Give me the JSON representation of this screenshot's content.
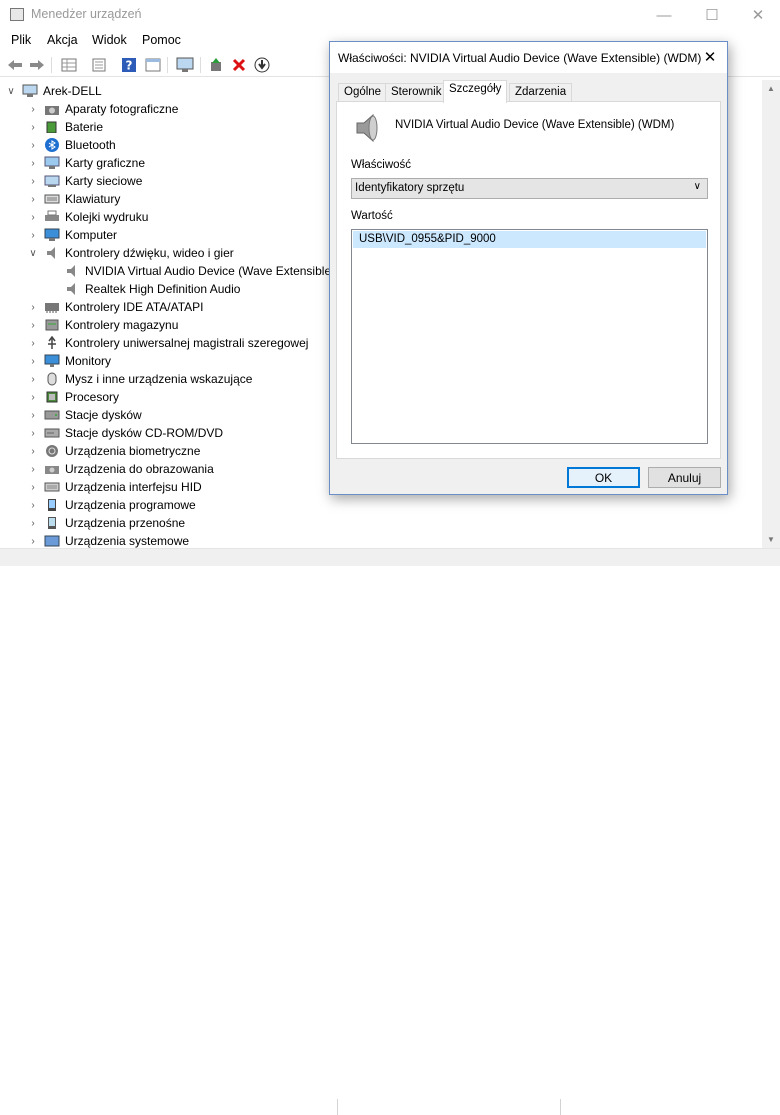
{
  "window": {
    "title": "Menedżer urządzeń"
  },
  "menu": [
    "Plik",
    "Akcja",
    "Widok",
    "Pomoc"
  ],
  "toolbar_icons": [
    "back-arrow-icon",
    "forward-arrow-icon",
    "properties-grid-icon",
    "list-icon",
    "help-icon",
    "show-hidden-icon",
    "monitor-icon",
    "update-driver-icon",
    "uninstall-icon",
    "download-icon"
  ],
  "tree": {
    "root": "Arek-DELL",
    "categories": [
      {
        "label": "Aparaty fotograficzne",
        "icon": "camera-icon"
      },
      {
        "label": "Baterie",
        "icon": "battery-icon"
      },
      {
        "label": "Bluetooth",
        "icon": "bluetooth-icon"
      },
      {
        "label": "Karty graficzne",
        "icon": "display-adapter-icon"
      },
      {
        "label": "Karty sieciowe",
        "icon": "network-adapter-icon"
      },
      {
        "label": "Klawiatury",
        "icon": "keyboard-icon"
      },
      {
        "label": "Kolejki wydruku",
        "icon": "printer-icon"
      },
      {
        "label": "Komputer",
        "icon": "computer-icon"
      },
      {
        "label": "Kontrolery dźwięku, wideo i gier",
        "icon": "speaker-icon",
        "expanded": true,
        "children": [
          "NVIDIA Virtual Audio Device (Wave Extensible) (WDM)",
          "Realtek High Definition Audio"
        ]
      },
      {
        "label": "Kontrolery IDE ATA/ATAPI",
        "icon": "ide-controller-icon"
      },
      {
        "label": "Kontrolery magazynu",
        "icon": "storage-controller-icon"
      },
      {
        "label": "Kontrolery uniwersalnej magistrali szeregowej",
        "icon": "usb-icon"
      },
      {
        "label": "Monitory",
        "icon": "monitor-icon"
      },
      {
        "label": "Mysz i inne urządzenia wskazujące",
        "icon": "mouse-icon"
      },
      {
        "label": "Procesory",
        "icon": "processor-icon"
      },
      {
        "label": "Stacje dysków",
        "icon": "disk-drive-icon"
      },
      {
        "label": "Stacje dysków CD-ROM/DVD",
        "icon": "cdrom-icon"
      },
      {
        "label": "Urządzenia biometryczne",
        "icon": "biometric-icon"
      },
      {
        "label": "Urządzenia do obrazowania",
        "icon": "imaging-icon"
      },
      {
        "label": "Urządzenia interfejsu HID",
        "icon": "hid-icon"
      },
      {
        "label": "Urządzenia programowe",
        "icon": "software-device-icon"
      },
      {
        "label": "Urządzenia przenośne",
        "icon": "portable-device-icon"
      },
      {
        "label": "Urządzenia systemowe",
        "icon": "system-device-icon"
      }
    ]
  },
  "dialog": {
    "title": "Właściwości: NVIDIA Virtual Audio Device (Wave Extensible) (WDM)",
    "tabs": [
      "Ogólne",
      "Sterownik",
      "Szczegóły",
      "Zdarzenia"
    ],
    "active_tab": "Szczegóły",
    "device_name": "NVIDIA Virtual Audio Device (Wave Extensible) (WDM)",
    "property_label": "Właściwość",
    "property_value": "Identyfikatory sprzętu",
    "value_label": "Wartość",
    "values": [
      "USB\\VID_0955&PID_9000"
    ],
    "ok": "OK",
    "cancel": "Anuluj"
  }
}
